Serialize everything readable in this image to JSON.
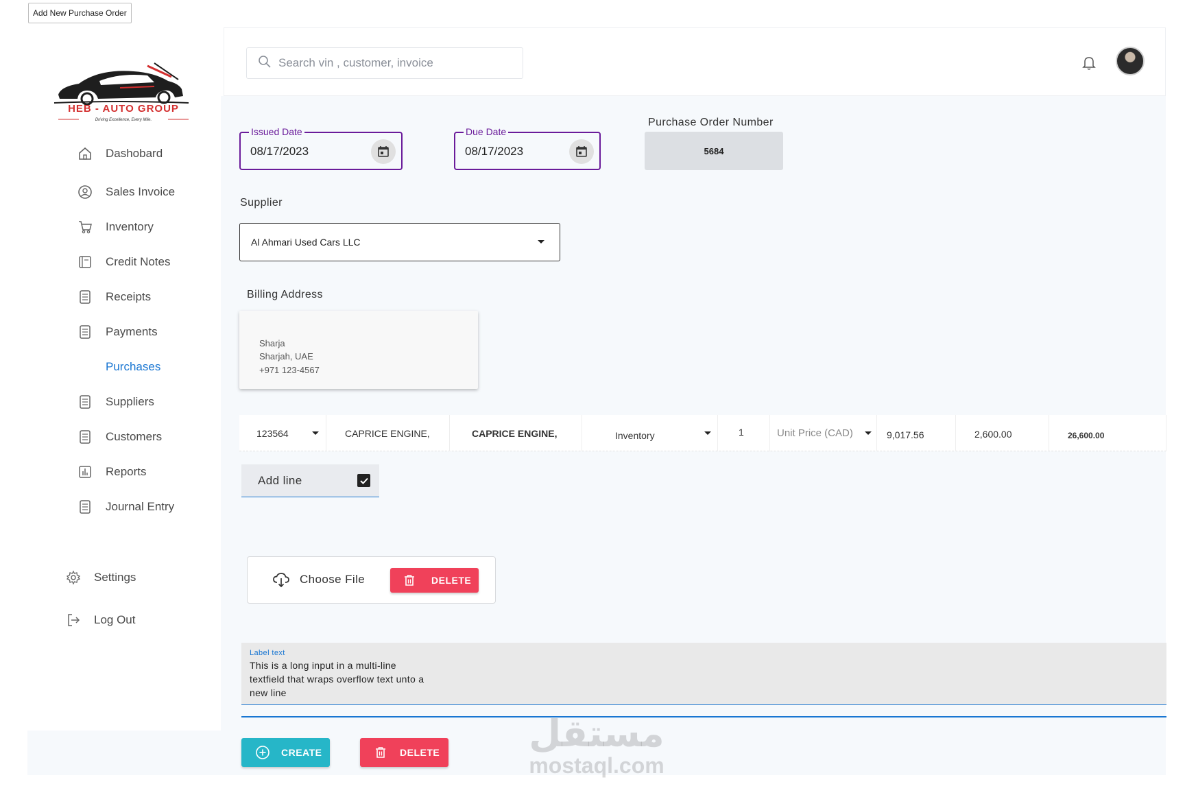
{
  "window_tab": "Add New Purchase Order",
  "brand": {
    "name": "HEB - AUTO GROUP",
    "tagline": "Driving Excellence, Every Mile.",
    "accent": "#d32f2f"
  },
  "sidebar": {
    "items": [
      {
        "label": "Dashobard",
        "icon": "home-icon"
      },
      {
        "label": "Sales Invoice",
        "icon": "user-circle-icon"
      },
      {
        "label": "Inventory",
        "icon": "cart-icon"
      },
      {
        "label": "Credit Notes",
        "icon": "notes-icon"
      },
      {
        "label": "Receipts",
        "icon": "document-list-icon"
      },
      {
        "label": "Payments",
        "icon": "document-list-icon"
      },
      {
        "label": "Purchases",
        "icon": "",
        "active": true
      },
      {
        "label": "Suppliers",
        "icon": "document-list-icon"
      },
      {
        "label": "Customers",
        "icon": "document-list-icon"
      },
      {
        "label": "Reports",
        "icon": "bar-chart-icon"
      },
      {
        "label": "Journal Entry",
        "icon": "document-list-icon"
      }
    ],
    "settings_label": "Settings",
    "logout_label": "Log Out"
  },
  "header": {
    "search_placeholder": "Search vin , customer, invoice"
  },
  "form": {
    "issued_date_label": "Issued Date",
    "issued_date_value": "08/17/2023",
    "due_date_label": "Due Date",
    "due_date_value": "08/17/2023",
    "po_number_label": "Purchase Order Number",
    "po_number_value": "5684",
    "supplier_label": "Supplier",
    "supplier_value": "Al Ahmari Used Cars LLC",
    "billing_label": "Billing Address",
    "billing_lines": [
      "Sharja",
      "Sharjah, UAE",
      "+971 123-4567"
    ]
  },
  "line_item": {
    "code": "123564",
    "name": "CAPRICE ENGINE,",
    "description": "CAPRICE ENGINE,",
    "account": "Inventory",
    "quantity": "1",
    "unit_price_label": "Unit Price (CAD)",
    "unit_price": "9,017.56",
    "amount": "2,600.00",
    "total": "26,600.00"
  },
  "add_line_label": "Add line",
  "file": {
    "choose_label": "Choose File",
    "delete_label": "DELETE"
  },
  "notes": {
    "label": "Label text",
    "value": "This is a long input in a multi-line textfield that wraps overflow text unto a new line"
  },
  "actions": {
    "create_label": "CREATE",
    "delete_label": "DELETE"
  },
  "watermark": {
    "arabic": "مستقل",
    "latin": "mostaql.com"
  },
  "colors": {
    "active_nav": "#1976d2",
    "purple": "#6a1b9a",
    "create": "#26b6c8",
    "delete": "#f0415a"
  }
}
